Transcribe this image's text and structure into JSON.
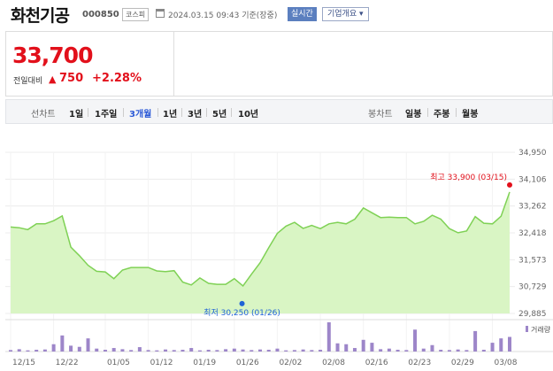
{
  "stock": {
    "name": "화천기공",
    "code": "000850",
    "market": "코스피",
    "datetime": "2024.03.15 09:43 기준(장중)",
    "realtime": "실시간",
    "company_info": "기업개요 ▾",
    "price": "33,700",
    "change_label": "전일대비",
    "change": "750",
    "change_pct": "+2.28%"
  },
  "period": {
    "line_label": "선차트",
    "items": [
      "1일",
      "1주일",
      "3개월",
      "1년",
      "3년",
      "5년",
      "10년"
    ],
    "active": "3개월",
    "candle_label": "봉차트",
    "candle_items": [
      "일봉",
      "주봉",
      "월봉"
    ]
  },
  "colors": {
    "up": "#e2101b",
    "low": "#1f64d6",
    "area": "#d9f5c4",
    "line": "#7fd155",
    "volume": "#9d86c9"
  },
  "chart_data": {
    "type": "area",
    "ylim": [
      29885,
      34950
    ],
    "y_ticks": [
      "34,950",
      "34,106",
      "33,262",
      "32,418",
      "31,573",
      "30,729",
      "29,885"
    ],
    "x_ticks": [
      "12/15",
      "12/22",
      "01/05",
      "01/12",
      "01/19",
      "01/26",
      "02/02",
      "02/08",
      "02/16",
      "02/23",
      "02/29",
      "03/08"
    ],
    "high_label": "최고 33,900 (03/15)",
    "low_label": "최저 30,250 (01/26)",
    "volume_label": "거래량",
    "series": [
      {
        "values": [
          32600,
          32580,
          32520,
          32700,
          32700,
          32800,
          32950,
          31970,
          31700,
          31400,
          31210,
          31190,
          30980,
          31250,
          31330,
          31330,
          31330,
          31220,
          31200,
          31230,
          30870,
          30780,
          31000,
          30830,
          30800,
          30800,
          30980,
          30750,
          31120,
          31480,
          31950,
          32400,
          32630,
          32750,
          32560,
          32650,
          32550,
          32700,
          32750,
          32700,
          32850,
          33200,
          33050,
          32900,
          32910,
          32900,
          32900,
          32700,
          32780,
          32970,
          32850,
          32550,
          32420,
          32480,
          32930,
          32720,
          32700,
          32940,
          33700
        ]
      }
    ],
    "volume": [
      0.05,
      0.08,
      0.04,
      0.06,
      0.07,
      0.25,
      0.55,
      0.2,
      0.16,
      0.45,
      0.1,
      0.06,
      0.12,
      0.08,
      0.05,
      0.15,
      0.05,
      0.04,
      0.07,
      0.05,
      0.06,
      0.12,
      0.04,
      0.06,
      0.05,
      0.08,
      0.1,
      0.07,
      0.05,
      0.07,
      0.06,
      0.1,
      0.04,
      0.05,
      0.07,
      0.05,
      0.06,
      1.0,
      0.28,
      0.25,
      0.12,
      0.4,
      0.3,
      0.08,
      0.1,
      0.06,
      0.05,
      0.75,
      0.1,
      0.22,
      0.06,
      0.05,
      0.07,
      0.05,
      0.7,
      0.06,
      0.3,
      0.45,
      0.5
    ]
  }
}
